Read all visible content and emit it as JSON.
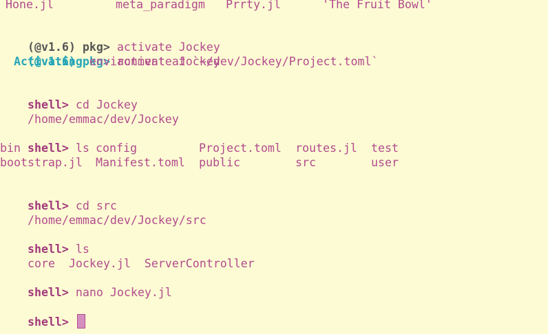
{
  "top_row": {
    "c1": "Hone.jl",
    "c2": "meta_paradigm",
    "c3": "Prrty.jl",
    "c4": "'The Fruit Bowl'"
  },
  "pkg_prompt": "(@v1.6) pkg>",
  "shell_prompt": "shell>",
  "lines": {
    "pkg1_cmd": "activate Jockey",
    "pkg2_cmd": "activate Jockey",
    "activating_word": "Activating",
    "activating_rest": "environment at `~/dev/Jockey/Project.toml`",
    "cd1_cmd": "cd Jockey",
    "cd1_out": "/home/emmac/dev/Jockey",
    "ls1_cmd": "ls",
    "ls1_row1": [
      "bin",
      "config",
      "Project.toml",
      "routes.jl",
      "test"
    ],
    "ls1_row2": [
      "bootstrap.jl",
      "Manifest.toml",
      "public",
      "src",
      "user"
    ],
    "cd2_cmd": "cd src",
    "cd2_out": "/home/emmac/dev/Jockey/src",
    "ls2_cmd": "ls",
    "ls2_out": "core  Jockey.jl  ServerController",
    "nano_cmd": "nano Jockey.jl"
  },
  "colors": {
    "background": "#fdfbd4",
    "text": "#b24b8d",
    "shell_prompt": "#a23a7c",
    "pkg_prompt": "#555555",
    "activating": "#27a6b8",
    "cursor": "#d58fbf"
  },
  "icons": {
    "cursor": "block-cursor-icon"
  }
}
